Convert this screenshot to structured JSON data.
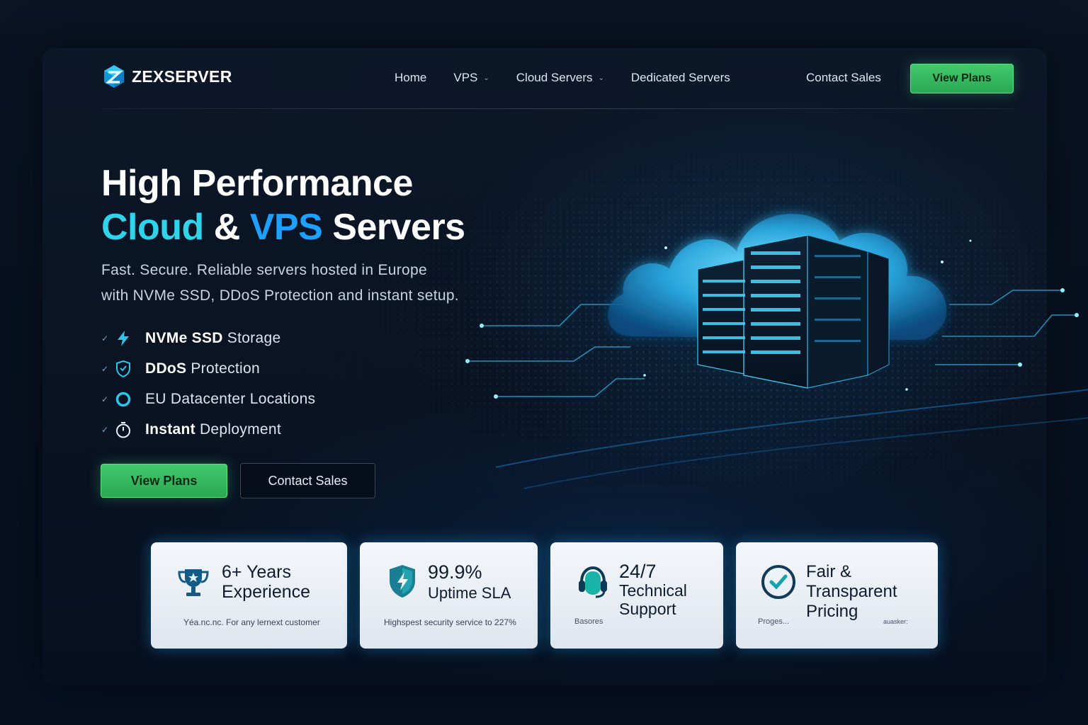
{
  "brand": {
    "name": "ZEXSERVER",
    "accent": "#2fd3ea",
    "primary_blue": "#1ea0ff",
    "cta_green": "#3bbf63"
  },
  "nav": {
    "links": [
      {
        "label": "Home",
        "has_dropdown": false
      },
      {
        "label": "VPS",
        "has_dropdown": true
      },
      {
        "label": "Cloud Servers",
        "has_dropdown": true
      },
      {
        "label": "Dedicated Servers",
        "has_dropdown": false
      }
    ],
    "contact_label": "Contact Sales",
    "cta_label": "View Plans"
  },
  "hero": {
    "title_line1": "High Performance",
    "title_word_cloud": "Cloud",
    "title_amp": " & ",
    "title_word_vps": "VPS",
    "title_word_servers": " Servers",
    "subtitle_line1": "Fast. Secure. Reliable servers hosted in Europe",
    "subtitle_line2": "with NVMe SSD, DDoS Protection and instant setup.",
    "features": [
      {
        "icon": "lightning-icon",
        "bold": "NVMe SSD",
        "rest": "Storage"
      },
      {
        "icon": "shield-icon",
        "bold": "DDoS",
        "rest": "Protection"
      },
      {
        "icon": "ring-icon",
        "bold": "",
        "rest": "EU Datacenter Locations"
      },
      {
        "icon": "stopwatch-icon",
        "bold": "Instant",
        "rest": "Deployment"
      }
    ],
    "primary_button": "View Plans",
    "secondary_button": "Contact Sales"
  },
  "stats": [
    {
      "icon": "trophy-icon",
      "title_line1": "6+ Years",
      "title_line2": "Experience",
      "note": "Yéa.nc.nc. For any lernext customer"
    },
    {
      "icon": "shield-lightning-icon",
      "title_line1": "99.9%",
      "title_line2": "Uptime SLA",
      "note": "Highspest security service to 227%"
    },
    {
      "icon": "headset-icon",
      "title_line1": "24/7",
      "title_line2": "Technical",
      "title_line3": "Support",
      "note": "Basores"
    },
    {
      "icon": "check-circle-icon",
      "title_line1": "Fair &",
      "title_line2": "Transparent",
      "title_line3": "Pricing",
      "note": "Proges...",
      "note_right": "auasker:"
    }
  ]
}
